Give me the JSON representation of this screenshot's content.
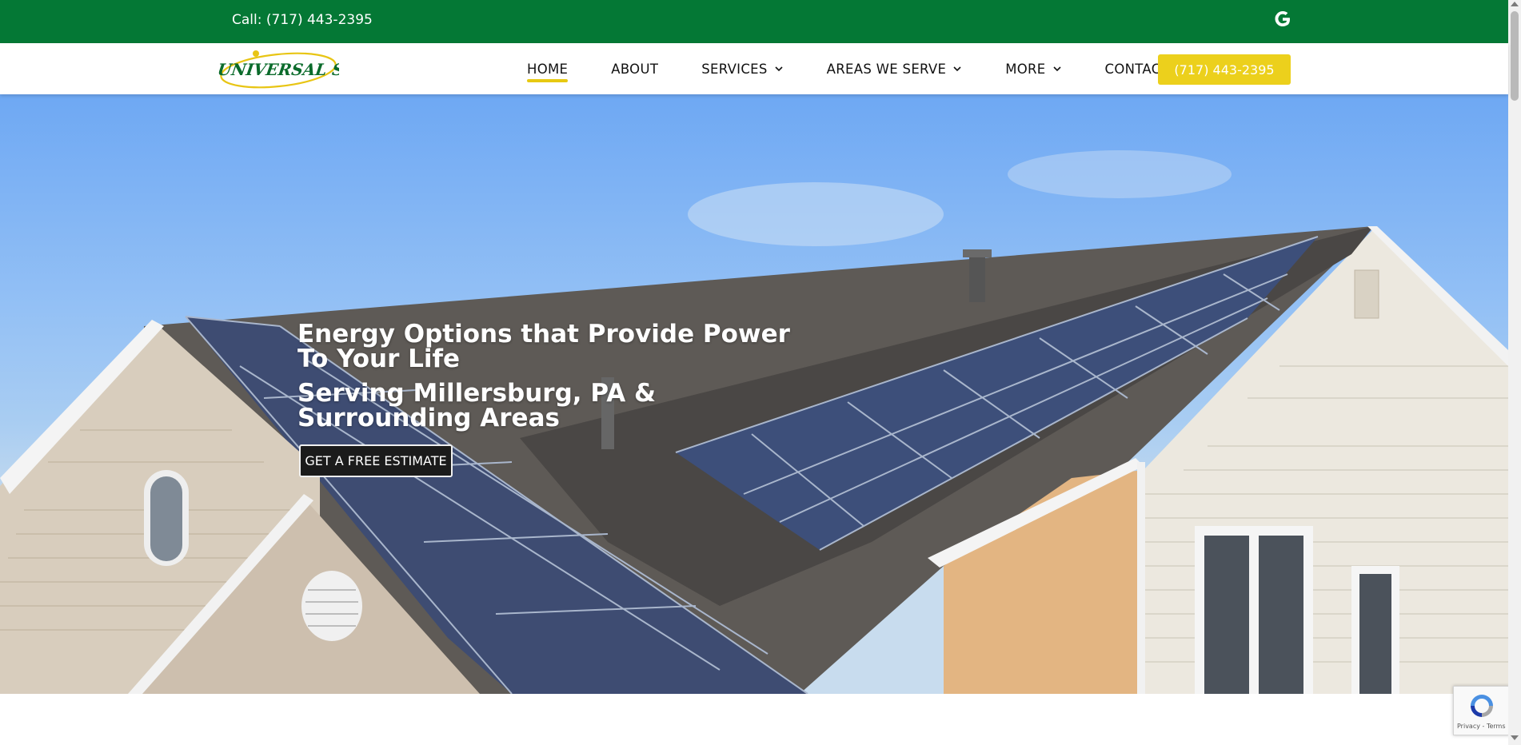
{
  "topbar": {
    "call_text": "Call: (717) 443-2395",
    "background": "#047835",
    "social_icon": "google-icon"
  },
  "brand": {
    "logo_text": "UNIVERSAL SOLAR"
  },
  "nav": {
    "items": [
      {
        "label": "HOME",
        "active": true,
        "dropdown": false
      },
      {
        "label": "ABOUT",
        "active": false,
        "dropdown": false
      },
      {
        "label": "SERVICES",
        "active": false,
        "dropdown": true
      },
      {
        "label": "AREAS WE SERVE",
        "active": false,
        "dropdown": true
      },
      {
        "label": "MORE",
        "active": false,
        "dropdown": true
      },
      {
        "label": "CONTACT",
        "active": false,
        "dropdown": false
      }
    ],
    "phone_button": "(717) 443-2395",
    "accent": "#ecd01c"
  },
  "hero": {
    "title": "Energy Options that Provide Power To Your Life",
    "subtitle": "Serving Millersburg, PA & Surrounding Areas",
    "cta": "GET A FREE ESTIMATE"
  },
  "recaptcha": {
    "links": "Privacy - Terms"
  }
}
